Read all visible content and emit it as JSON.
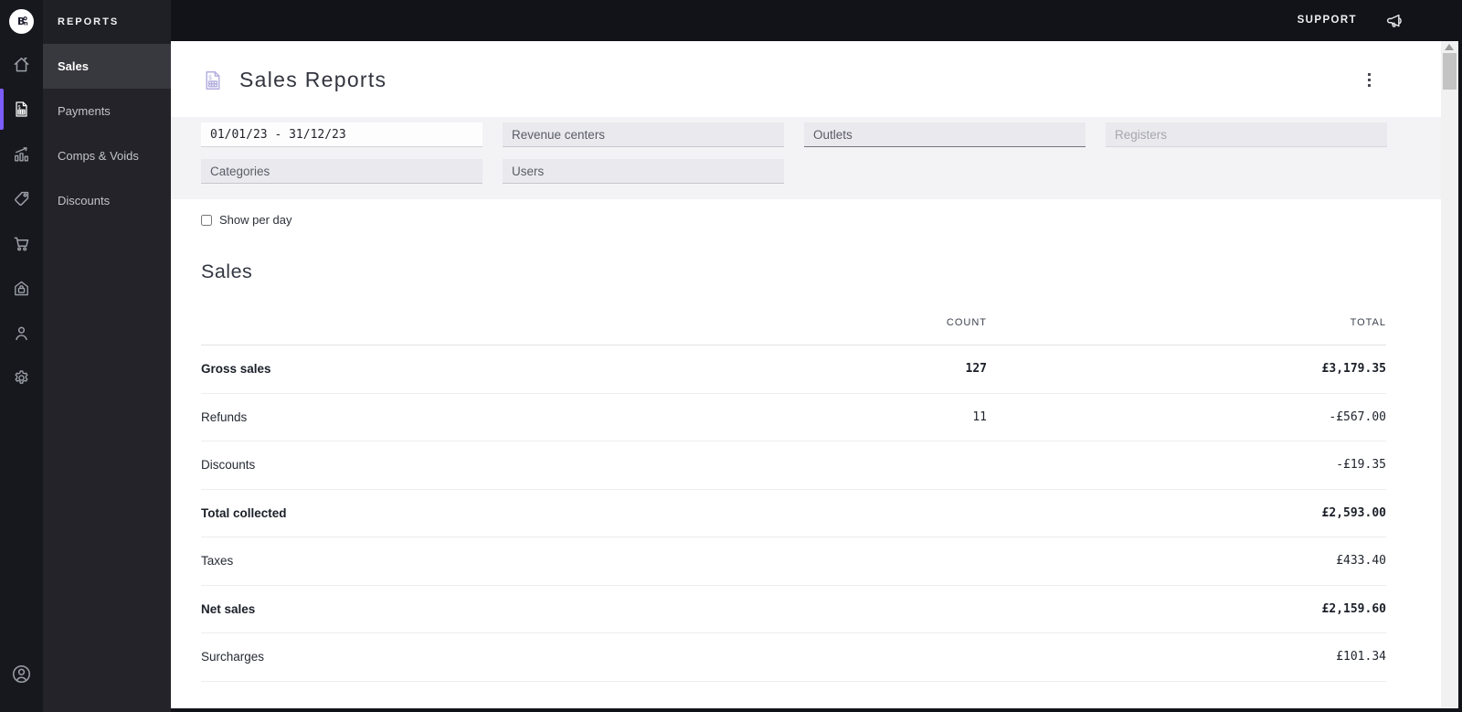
{
  "brand": {
    "logo_text": "B",
    "logo_sub": "n"
  },
  "topbar": {
    "support_label": "SUPPORT",
    "icons": [
      "megaphone-icon"
    ]
  },
  "rail": {
    "items": [
      {
        "icon": "home-icon",
        "active": false
      },
      {
        "icon": "reports-receipt-icon",
        "active": true
      },
      {
        "icon": "analytics-chart-icon",
        "active": false
      },
      {
        "icon": "tag-icon",
        "active": false
      },
      {
        "icon": "cart-icon",
        "active": false
      },
      {
        "icon": "venue-lock-icon",
        "active": false
      },
      {
        "icon": "customers-icon",
        "active": false
      },
      {
        "icon": "settings-gear-icon",
        "active": false
      }
    ],
    "bottom_icon": "account-icon"
  },
  "sidebar": {
    "title": "REPORTS",
    "items": [
      {
        "label": "Sales",
        "active": true
      },
      {
        "label": "Payments",
        "active": false
      },
      {
        "label": "Comps & Voids",
        "active": false
      },
      {
        "label": "Discounts",
        "active": false
      }
    ]
  },
  "page": {
    "title": "Sales Reports",
    "title_icon": "sales-report-receipt-icon",
    "menu_icon": "kebab-menu-icon",
    "filters": {
      "date_range_value": "01/01/23 - 31/12/23",
      "revenue_centers_placeholder": "Revenue centers",
      "outlets_placeholder": "Outlets",
      "registers_placeholder": "Registers",
      "categories_placeholder": "Categories",
      "users_placeholder": "Users"
    },
    "show_per_day_label": "Show per day",
    "show_per_day_checked": false,
    "section_title": "Sales",
    "table": {
      "headers": {
        "count": "COUNT",
        "total": "TOTAL"
      },
      "rows": [
        {
          "label": "Gross sales",
          "count": "127",
          "total": "£3,179.35",
          "bold": true
        },
        {
          "label": "Refunds",
          "count": "11",
          "total": "-£567.00",
          "bold": false
        },
        {
          "label": "Discounts",
          "count": "",
          "total": "-£19.35",
          "bold": false
        },
        {
          "label": "Total collected",
          "count": "",
          "total": "£2,593.00",
          "bold": true
        },
        {
          "label": "Taxes",
          "count": "",
          "total": "£433.40",
          "bold": false
        },
        {
          "label": "Net sales",
          "count": "",
          "total": "£2,159.60",
          "bold": true
        },
        {
          "label": "Surcharges",
          "count": "",
          "total": "£101.34",
          "bold": false
        }
      ]
    }
  },
  "colors": {
    "accent_purple": "#7c5cfa",
    "topbar_bg": "#121318",
    "rail_bg": "#17181d",
    "sidebar_bg": "#232329",
    "sidebar_active_bg": "#38383f",
    "filter_band_bg": "#f3f3f5",
    "field_bg": "#e9e9ee",
    "title_icon_color": "#b3aede"
  }
}
